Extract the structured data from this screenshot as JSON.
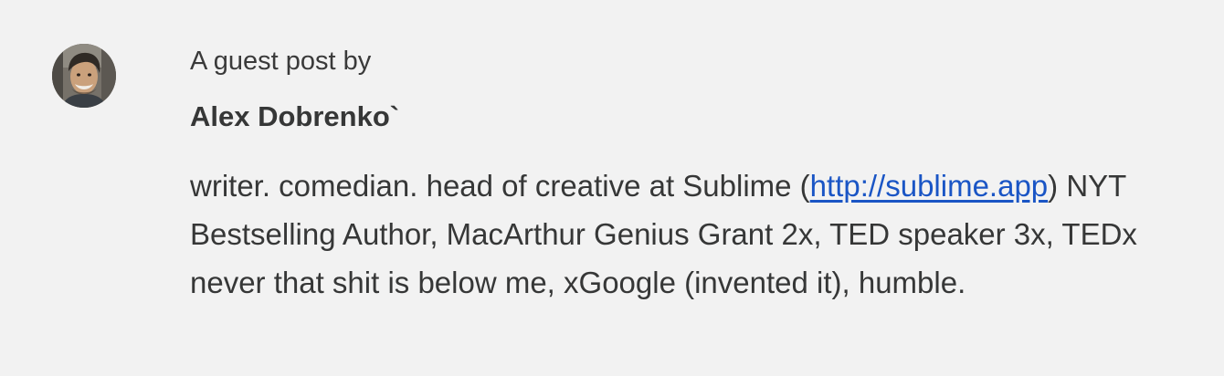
{
  "guest_post": {
    "intro": "A guest post by",
    "author": {
      "name": "Alex Dobrenko`",
      "avatar_icon": "author-photo"
    },
    "bio": {
      "before_link": "writer. comedian. head of creative at Sublime (",
      "link_text": "http://sublime.app",
      "after_link": ") NYT Bestselling Author, MacArthur Genius Grant 2x, TED speaker 3x, TEDx never that shit is below me, xGoogle (invented it), humble."
    },
    "colors": {
      "background": "#f2f2f2",
      "text": "#363737",
      "link": "#1a55c5"
    }
  }
}
